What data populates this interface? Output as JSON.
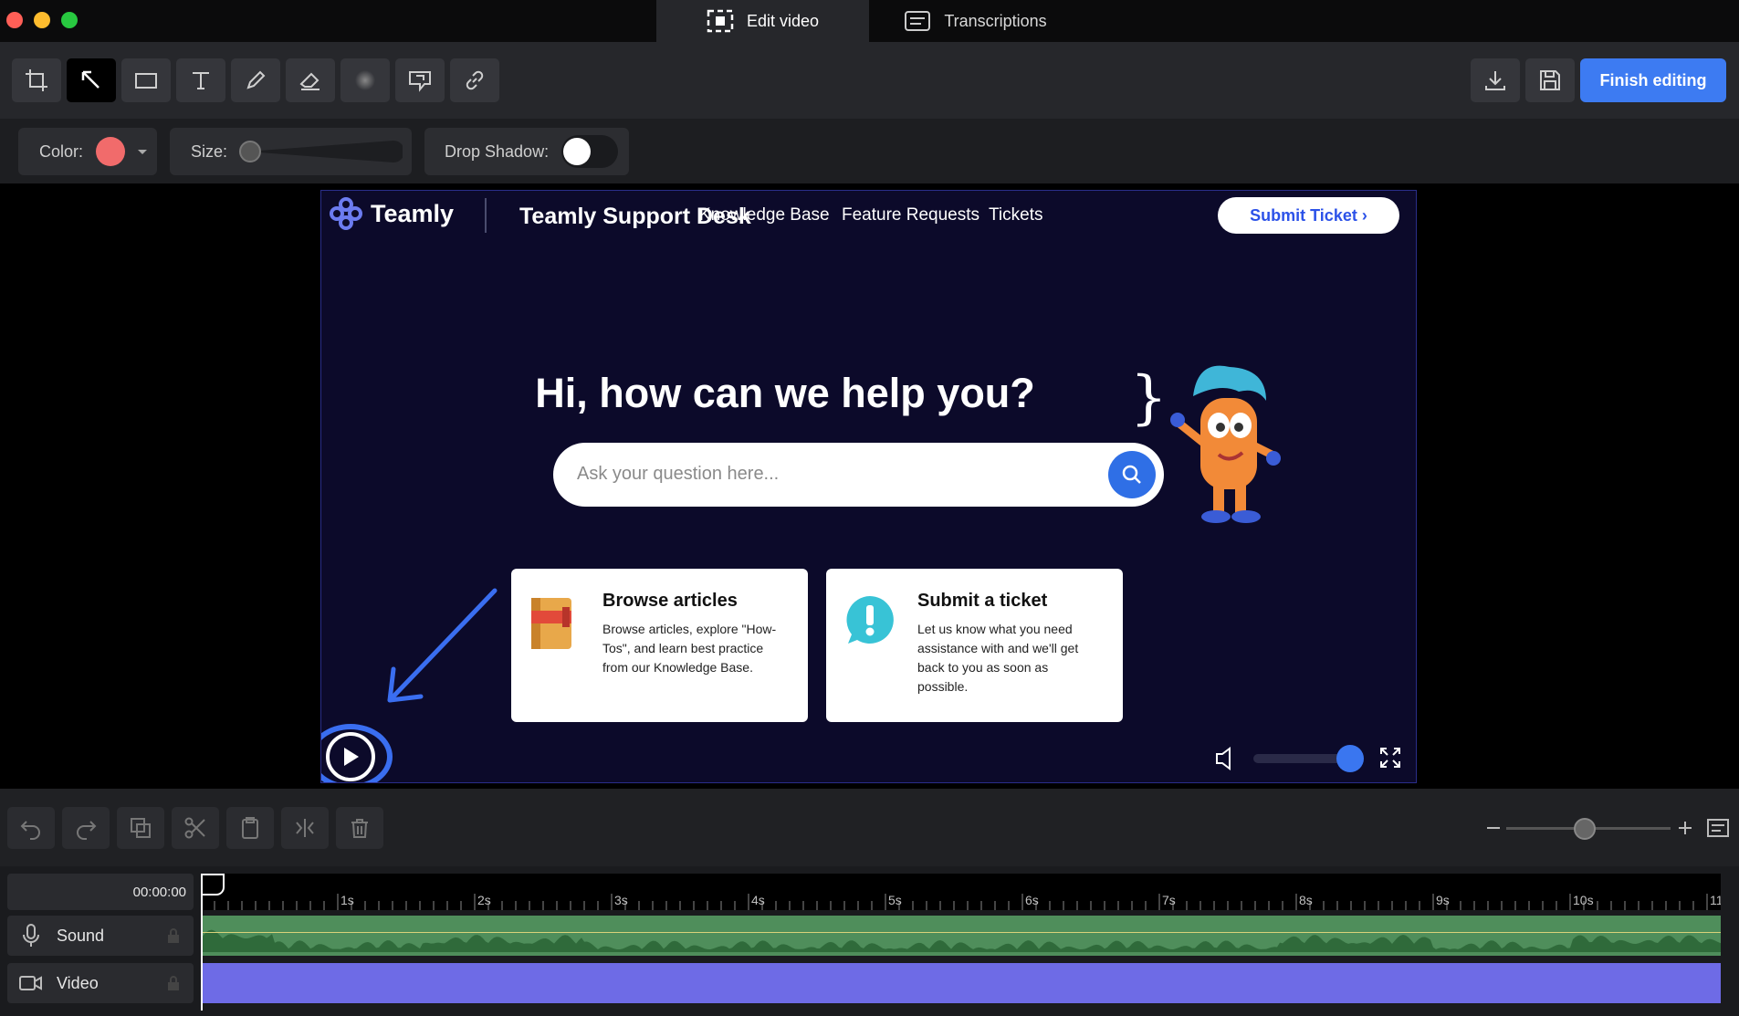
{
  "window": {
    "tabs": [
      {
        "label": "Edit video",
        "icon": "screen-capture-icon",
        "active": true
      },
      {
        "label": "Transcriptions",
        "icon": "transcript-icon",
        "active": false
      }
    ]
  },
  "toolbar": {
    "tools": [
      "crop-icon",
      "arrow-icon",
      "rectangle-icon",
      "text-icon",
      "pen-icon",
      "eraser-icon",
      "blur-icon",
      "callout-icon",
      "link-icon"
    ],
    "active_tool": "arrow-icon",
    "finish_label": "Finish editing"
  },
  "properties": {
    "color_label": "Color:",
    "color_value": "#f16b6b",
    "size_label": "Size:",
    "shadow_label": "Drop Shadow:",
    "drop_shadow_on": false
  },
  "video": {
    "brand": "Teamly",
    "desk_title": "Teamly Support Desk",
    "nav": [
      "Knowledge Base",
      "Feature Requests",
      "Tickets"
    ],
    "submit_button": "Submit Ticket ›",
    "hero": "Hi, how can we help you?",
    "search_placeholder": "Ask your question here...",
    "cards": [
      {
        "title": "Browse articles",
        "body": "Browse articles, explore \"How-Tos\", and learn best practice from our Knowledge Base.",
        "icon": "book-icon"
      },
      {
        "title": "Submit a ticket",
        "body": "Let us know what you need assistance with and we'll get back to you as soon as possible.",
        "icon": "alert-bubble-icon"
      }
    ],
    "volume": 1.0
  },
  "timeline": {
    "current_time": "00:00:00",
    "ticks": [
      "1s",
      "2s",
      "3s",
      "4s",
      "5s",
      "6s",
      "7s",
      "8s",
      "9s",
      "10s",
      "11"
    ],
    "tracks": [
      {
        "label": "Sound",
        "icon": "microphone-icon"
      },
      {
        "label": "Video",
        "icon": "video-camera-icon"
      }
    ]
  },
  "colors": {
    "accent": "#3d7bf2",
    "sound_track": "#4f8e5b",
    "video_track": "#6e6be6"
  }
}
